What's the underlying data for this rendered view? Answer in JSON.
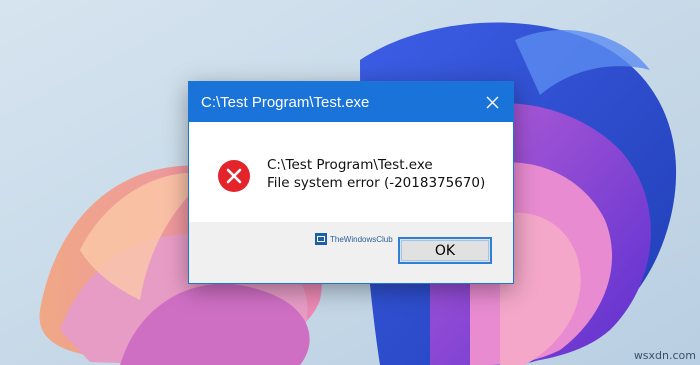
{
  "dialog": {
    "title": "C:\\Test Program\\Test.exe",
    "message_line1": "C:\\Test Program\\Test.exe",
    "message_line2": "File system error (-2018375670)",
    "ok_label": "OK",
    "icon": "error-icon",
    "close_icon": "close-icon"
  },
  "watermark": {
    "text": "TheWindowsClub"
  },
  "corner_watermark": "wsxdn.com",
  "colors": {
    "titlebar": "#1a73d9",
    "error_red": "#e3242b",
    "button_border": "#2f7fd6"
  }
}
